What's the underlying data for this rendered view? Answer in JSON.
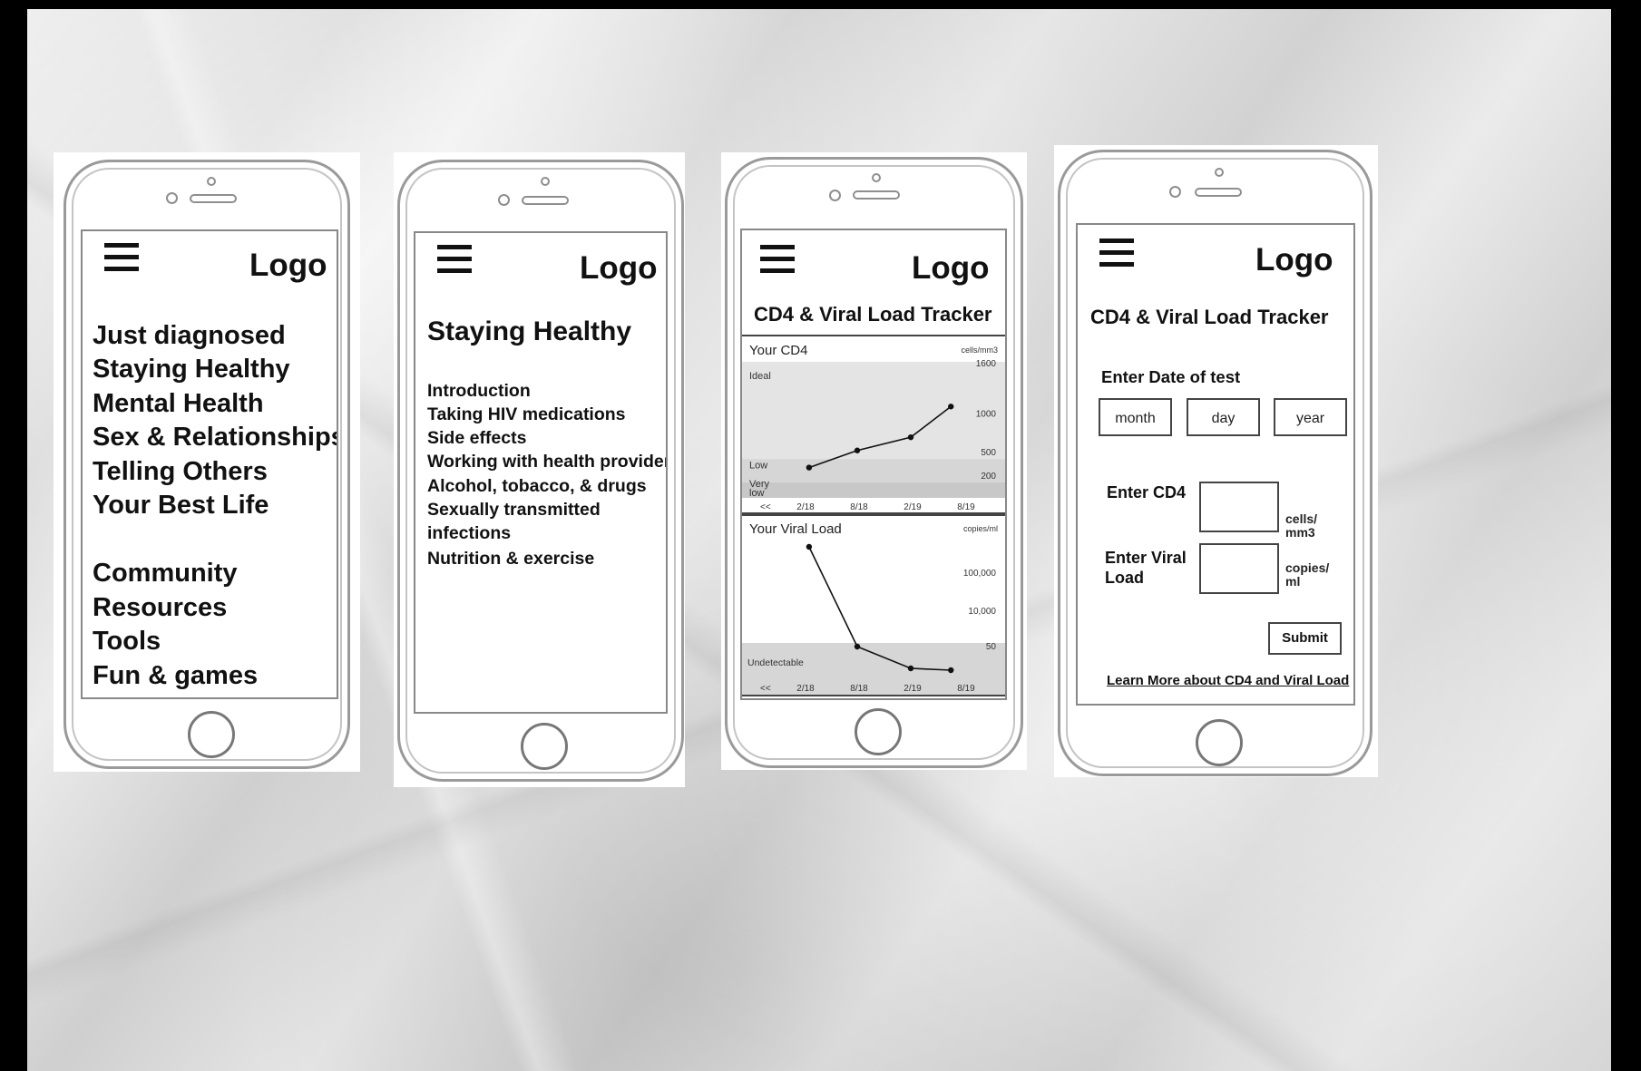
{
  "phone1": {
    "logo": "Logo",
    "menu": [
      "Just diagnosed",
      "Staying Healthy",
      "Mental Health",
      "Sex & Relationships",
      "Telling Others",
      "Your Best Life"
    ],
    "menu2": [
      "Community",
      "Resources",
      "Tools",
      "Fun & games"
    ]
  },
  "phone2": {
    "logo": "Logo",
    "heading": "Staying Healthy",
    "items": [
      "Introduction",
      "Taking HIV medications",
      "Side effects",
      "Working with health providers",
      "Alcohol, tobacco, & drugs",
      "Sexually transmitted",
      "infections",
      "Nutrition & exercise"
    ]
  },
  "phone3": {
    "logo": "Logo",
    "title": "CD4 & Viral Load Tracker"
  },
  "phone4": {
    "logo": "Logo",
    "title": "CD4 & Viral Load Tracker",
    "date_label": "Enter Date of test",
    "month": "month",
    "day": "day",
    "year": "year",
    "cd4_label": "Enter CD4",
    "cd4_unit": "cells/ mm3",
    "vl_label": "Enter Viral Load",
    "vl_unit": "copies/ ml",
    "submit": "Submit",
    "learn_more": "Learn More about CD4 and Viral Load"
  },
  "chart_data": [
    {
      "type": "line",
      "title": "Your CD4",
      "unit_label": "cells/mm3",
      "x": [
        "2/18",
        "8/18",
        "2/19",
        "8/19"
      ],
      "nav_label": "<<",
      "ytick_labels": [
        "1600",
        "1000",
        "500",
        "200"
      ],
      "ytick_values": [
        1600,
        1000,
        500,
        200
      ],
      "band_labels": [
        "Ideal",
        "Low",
        "Very low"
      ],
      "bands": [
        {
          "label": "Ideal",
          "from": 500,
          "to": 1750,
          "color": "#e4e4e4"
        },
        {
          "label": "Low",
          "from": 200,
          "to": 500,
          "color": "#d6d6d6"
        },
        {
          "label": "Very low",
          "from": 0,
          "to": 200,
          "color": "#c8c8c8"
        }
      ],
      "values": [
        [
          0.1,
          390
        ],
        [
          1.0,
          610
        ],
        [
          2.0,
          780
        ],
        [
          2.75,
          1175
        ]
      ],
      "ylim": [
        0,
        1750
      ]
    },
    {
      "type": "line",
      "title": "Your Viral Load",
      "unit_label": "copies/ml",
      "x": [
        "2/18",
        "8/18",
        "2/19",
        "8/19"
      ],
      "nav_label": "<<",
      "ytick_labels": [
        "100,000",
        "10,000",
        "50"
      ],
      "band_labels": [
        "Undetectable"
      ],
      "bands": [
        {
          "label": "Undetectable",
          "color": "#d6d6d6"
        }
      ],
      "values": [
        [
          0.1,
          1000000
        ],
        [
          1.0,
          55
        ],
        [
          2.0,
          20
        ],
        [
          2.75,
          18
        ]
      ],
      "log_scale": true
    }
  ],
  "colors": {
    "page_bg": "#000000",
    "line": "#111111",
    "screen_border": "#888888"
  }
}
